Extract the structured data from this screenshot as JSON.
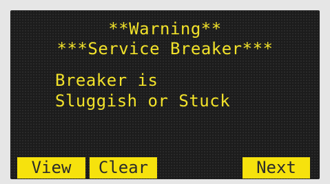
{
  "screen": {
    "title_line1": "**Warning**",
    "title_line2": "***Service Breaker***",
    "message_line1": "Breaker is",
    "message_line2": "Sluggish or Stuck"
  },
  "softkeys": {
    "view": "View",
    "clear": "Clear",
    "next": "Next"
  },
  "colors": {
    "text": "#f2e22a",
    "softkey_bg": "#f6e20d",
    "softkey_text": "#2b2b2b",
    "screen_bg": "#1c1c1c",
    "bezel": "#e6e6e6"
  }
}
